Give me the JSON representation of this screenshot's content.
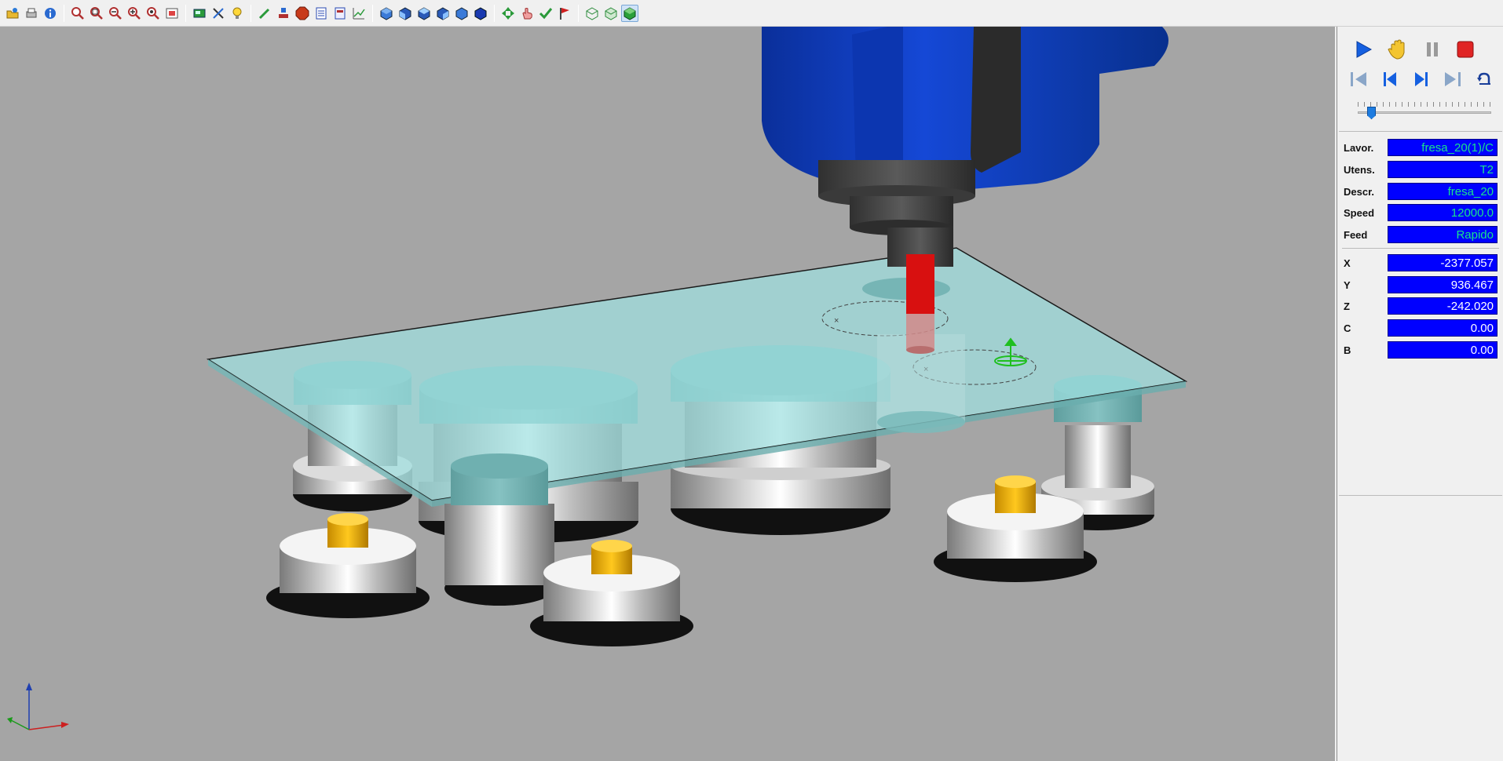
{
  "toolbar": {
    "groups": [
      [
        "open-icon",
        "print-icon",
        "info-icon"
      ],
      [
        "zoom-icon",
        "zoom-window-icon",
        "zoom-out-icon",
        "zoom-in-icon",
        "zoom-fit-icon",
        "frame-icon"
      ],
      [
        "screenshot-icon",
        "tools-icon",
        "light-bulb-icon"
      ],
      [
        "edit-path-icon",
        "machine-icon",
        "stop-sign-icon",
        "report-icon",
        "nc-file-icon",
        "graph-icon"
      ],
      [
        "view-iso-icon",
        "view-front-icon",
        "view-top-icon",
        "view-side-icon",
        "view-back-icon",
        "view-solid-icon"
      ],
      [
        "move-icon",
        "hand-pointer-icon",
        "check-icon",
        "flag-icon"
      ],
      [
        "wireframe-icon",
        "transparent-icon",
        "shaded-icon"
      ]
    ],
    "active": "shaded-icon"
  },
  "controls": {
    "play": "play-icon",
    "hand": "hand-icon",
    "pause": "pause-icon",
    "stop": "stop-icon",
    "first": "first-icon",
    "prev": "step-back-icon",
    "next": "step-forward-icon",
    "last": "last-icon",
    "reset": "reset-icon",
    "speed_position": 0.1
  },
  "info": {
    "lavor_label": "Lavor.",
    "lavor_value": "fresa_20(1)/C",
    "utens_label": "Utens.",
    "utens_value": "T2",
    "descr_label": "Descr.",
    "descr_value": "fresa_20",
    "speed_label": "Speed",
    "speed_value": "12000.0",
    "feed_label": "Feed",
    "feed_value": "Rapido",
    "x_label": "X",
    "x_value": "-2377.057",
    "y_label": "Y",
    "y_value": "936.467",
    "z_label": "Z",
    "z_value": "-242.020",
    "c_label": "C",
    "c_value": "0.00",
    "b_label": "B",
    "b_value": "0.00"
  },
  "colors": {
    "viewport_bg": "#a5a5a5",
    "spindle_blue": "#0a3db8",
    "panel_glass": "#9fe0e0",
    "tool_red": "#e01010",
    "pin_yellow": "#f0b800",
    "field_bg": "#0000ff",
    "field_text_green": "#19e38a",
    "field_text_white": "#ffffff"
  }
}
